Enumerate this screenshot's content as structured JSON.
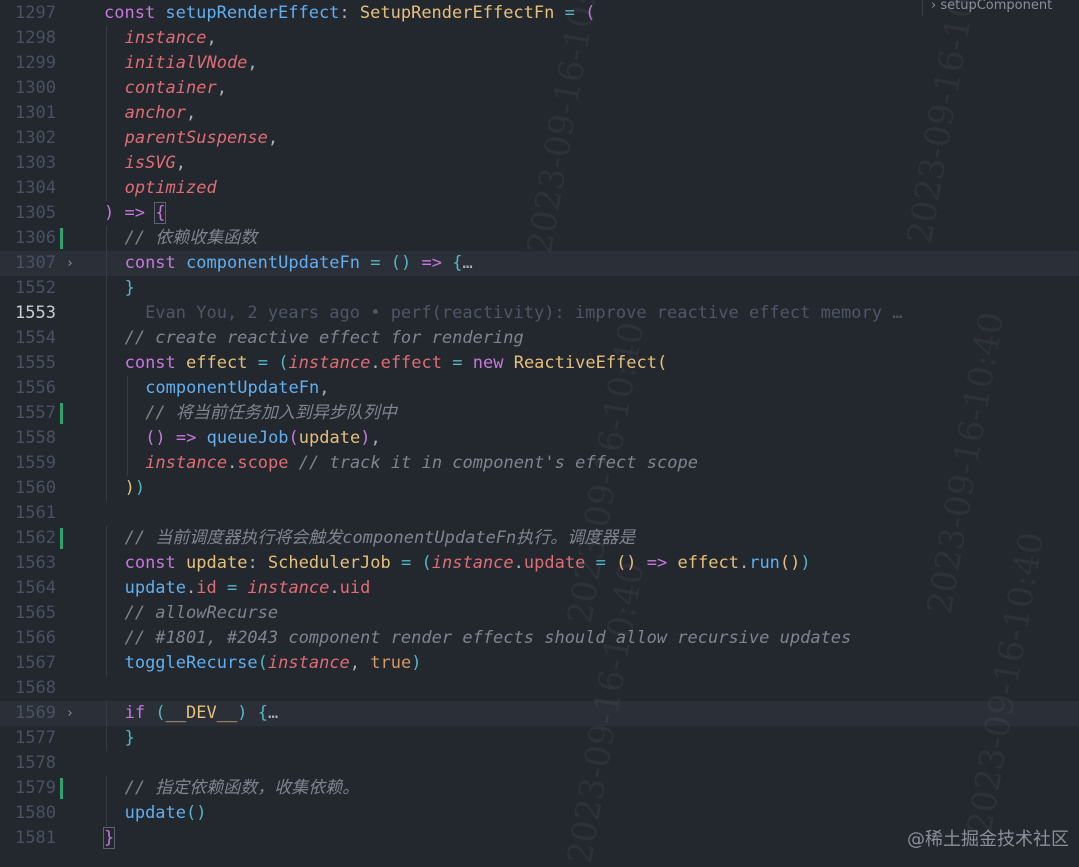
{
  "breadcrumb": {
    "chevron": "›",
    "label": "setupComponent"
  },
  "watermark": "@稀土掘金技术社区",
  "stamp_text": "2023-09-16-10:40",
  "fold_icon": "chevron-right-icon",
  "ellipsis": "…",
  "lines": [
    {
      "n": "1297",
      "t": "const setupRenderEffect: SetupRenderEffectFn = ("
    },
    {
      "n": "1298",
      "t": "instance,"
    },
    {
      "n": "1299",
      "t": "initialVNode,"
    },
    {
      "n": "1300",
      "t": "container,"
    },
    {
      "n": "1301",
      "t": "anchor,"
    },
    {
      "n": "1302",
      "t": "parentSuspense,"
    },
    {
      "n": "1303",
      "t": "isSVG,"
    },
    {
      "n": "1304",
      "t": "optimized"
    },
    {
      "n": "1305",
      "t": ") => {"
    },
    {
      "n": "1306",
      "t": "// 依赖收集函数"
    },
    {
      "n": "1307",
      "t": "const componentUpdateFn = () => {…"
    },
    {
      "n": "1552",
      "t": "}"
    },
    {
      "n": "1553",
      "t": "Evan You, 2 years ago • perf(reactivity): improve reactive effect memory …"
    },
    {
      "n": "1554",
      "t": "// create reactive effect for rendering"
    },
    {
      "n": "1555",
      "t": "const effect = (instance.effect = new ReactiveEffect("
    },
    {
      "n": "1556",
      "t": "componentUpdateFn,"
    },
    {
      "n": "1557",
      "t": "// 将当前任务加入到异步队列中"
    },
    {
      "n": "1558",
      "t": "() => queueJob(update),"
    },
    {
      "n": "1559",
      "t": "instance.scope // track it in component's effect scope"
    },
    {
      "n": "1560",
      "t": "))"
    },
    {
      "n": "1561",
      "t": ""
    },
    {
      "n": "1562",
      "t": "// 当前调度器执行将会触发componentUpdateFn执行。调度器是"
    },
    {
      "n": "1563",
      "t": "const update: SchedulerJob = (instance.update = () => effect.run())"
    },
    {
      "n": "1564",
      "t": "update.id = instance.uid"
    },
    {
      "n": "1565",
      "t": "// allowRecurse"
    },
    {
      "n": "1566",
      "t": "// #1801, #2043 component render effects should allow recursive updates"
    },
    {
      "n": "1567",
      "t": "toggleRecurse(instance, true)"
    },
    {
      "n": "1568",
      "t": ""
    },
    {
      "n": "1569",
      "t": "if (__DEV__) {…"
    },
    {
      "n": "1577",
      "t": "}"
    },
    {
      "n": "1578",
      "t": ""
    },
    {
      "n": "1579",
      "t": "// 指定依赖函数，收集依赖。"
    },
    {
      "n": "1580",
      "t": "update()"
    },
    {
      "n": "1581",
      "t": "}"
    }
  ],
  "colors": {
    "background": "#23272e",
    "keyword": "#c678dd",
    "function": "#61afef",
    "type": "#e5c07b",
    "parameter": "#e06c75",
    "comment": "#7f848e",
    "operator": "#56b6c2",
    "git_added": "#2fa36b"
  }
}
